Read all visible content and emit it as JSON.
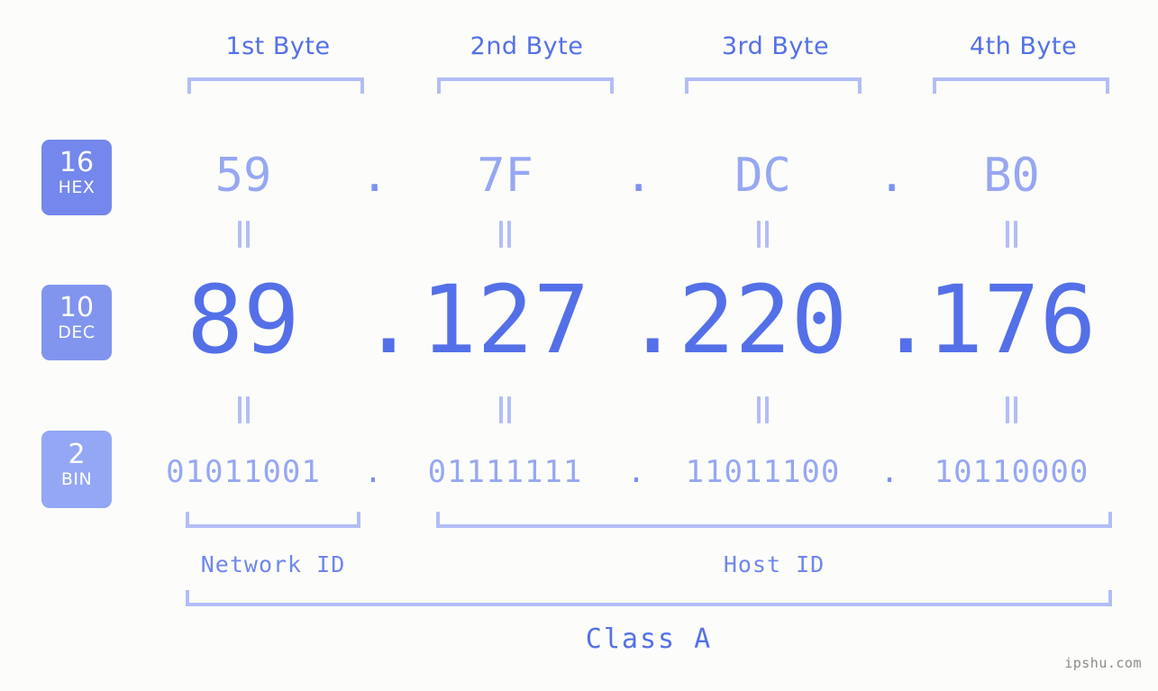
{
  "meta": {
    "watermark": "ipshu.com",
    "background_color": "#fcfdfa",
    "accent_strong": "#5470e8",
    "accent_light": "#97a7f2",
    "accent_pale": "#b3bdf7"
  },
  "byte_headers": [
    {
      "label": "1st Byte"
    },
    {
      "label": "2nd Byte"
    },
    {
      "label": "3rd Byte"
    },
    {
      "label": "4th Byte"
    }
  ],
  "bases": [
    {
      "radix": "16",
      "name": "HEX",
      "color": "#7487ec"
    },
    {
      "radix": "10",
      "name": "DEC",
      "color": "#8195ee"
    },
    {
      "radix": "2",
      "name": "BIN",
      "color": "#93a7f4"
    }
  ],
  "separators": {
    "hex": ".",
    "dec": ".",
    "bin": "."
  },
  "rows": {
    "hex": {
      "label": "HEX",
      "values": [
        "59",
        "7F",
        "DC",
        "B0"
      ]
    },
    "dec": {
      "label": "DEC",
      "values": [
        "89",
        "127",
        "220",
        "176"
      ]
    },
    "bin": {
      "label": "BIN",
      "values": [
        "01011001",
        "01111111",
        "11011100",
        "10110000"
      ]
    }
  },
  "equality_marks": {
    "glyph": "||",
    "count_per_row": 4
  },
  "id_split": {
    "network": {
      "label": "Network ID",
      "bytes": 1
    },
    "host": {
      "label": "Host ID",
      "bytes": 3
    }
  },
  "class": {
    "label": "Class A"
  }
}
